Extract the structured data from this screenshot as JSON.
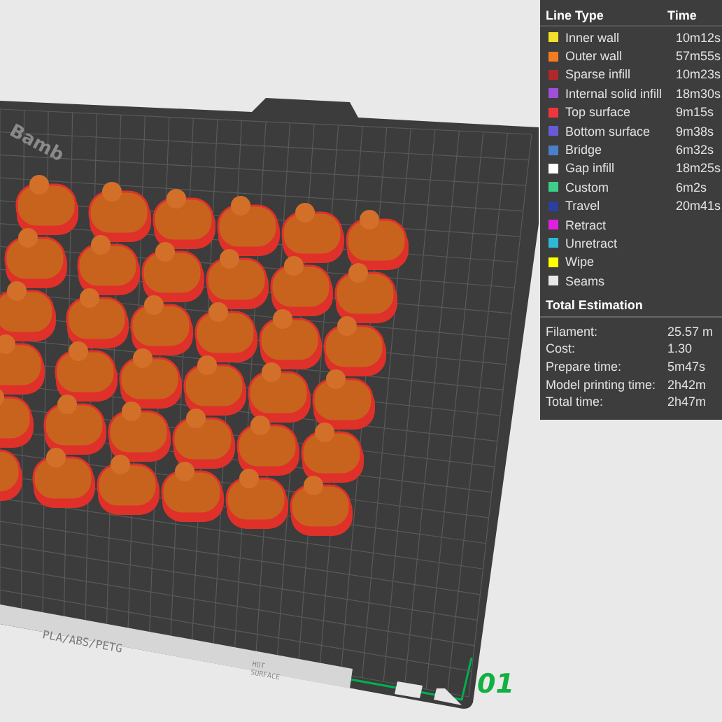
{
  "plate": {
    "brand": "Bamb",
    "material": "PLA/ABS/PETG",
    "warning": "HOT\nSURFACE",
    "number": "01"
  },
  "legend": {
    "headers": [
      "Line Type",
      "Time"
    ],
    "items": [
      {
        "label": "Inner wall",
        "time": "10m12s",
        "color": "#f4e02a"
      },
      {
        "label": "Outer wall",
        "time": "57m55s",
        "color": "#f47b20"
      },
      {
        "label": "Sparse infill",
        "time": "10m23s",
        "color": "#b0282a"
      },
      {
        "label": "Internal solid infill",
        "time": "18m30s",
        "color": "#a04fd8"
      },
      {
        "label": "Top surface",
        "time": "9m15s",
        "color": "#f0363c"
      },
      {
        "label": "Bottom surface",
        "time": "9m38s",
        "color": "#6a5ad8"
      },
      {
        "label": "Bridge",
        "time": "6m32s",
        "color": "#4a80c8"
      },
      {
        "label": "Gap infill",
        "time": "18m25s",
        "color": "#ffffff"
      },
      {
        "label": "Custom",
        "time": "6m2s",
        "color": "#3ccf8a"
      },
      {
        "label": "Travel",
        "time": "20m41s",
        "color": "#2c3ea0"
      },
      {
        "label": "Retract",
        "color": "#e020e0"
      },
      {
        "label": "Unretract",
        "color": "#30b8d8"
      },
      {
        "label": "Wipe",
        "color": "#ffff00"
      },
      {
        "label": "Seams",
        "color": "#e8e8e8"
      }
    ]
  },
  "estimation": {
    "title": "Total Estimation",
    "rows": [
      {
        "label": "Filament:",
        "value": "25.57 m"
      },
      {
        "label": "Cost:",
        "value": "1.30"
      },
      {
        "label": "Prepare time:",
        "value": "5m47s"
      },
      {
        "label": "Model printing time:",
        "value": "2h42m"
      },
      {
        "label": "Total time:",
        "value": "2h47m"
      }
    ]
  }
}
